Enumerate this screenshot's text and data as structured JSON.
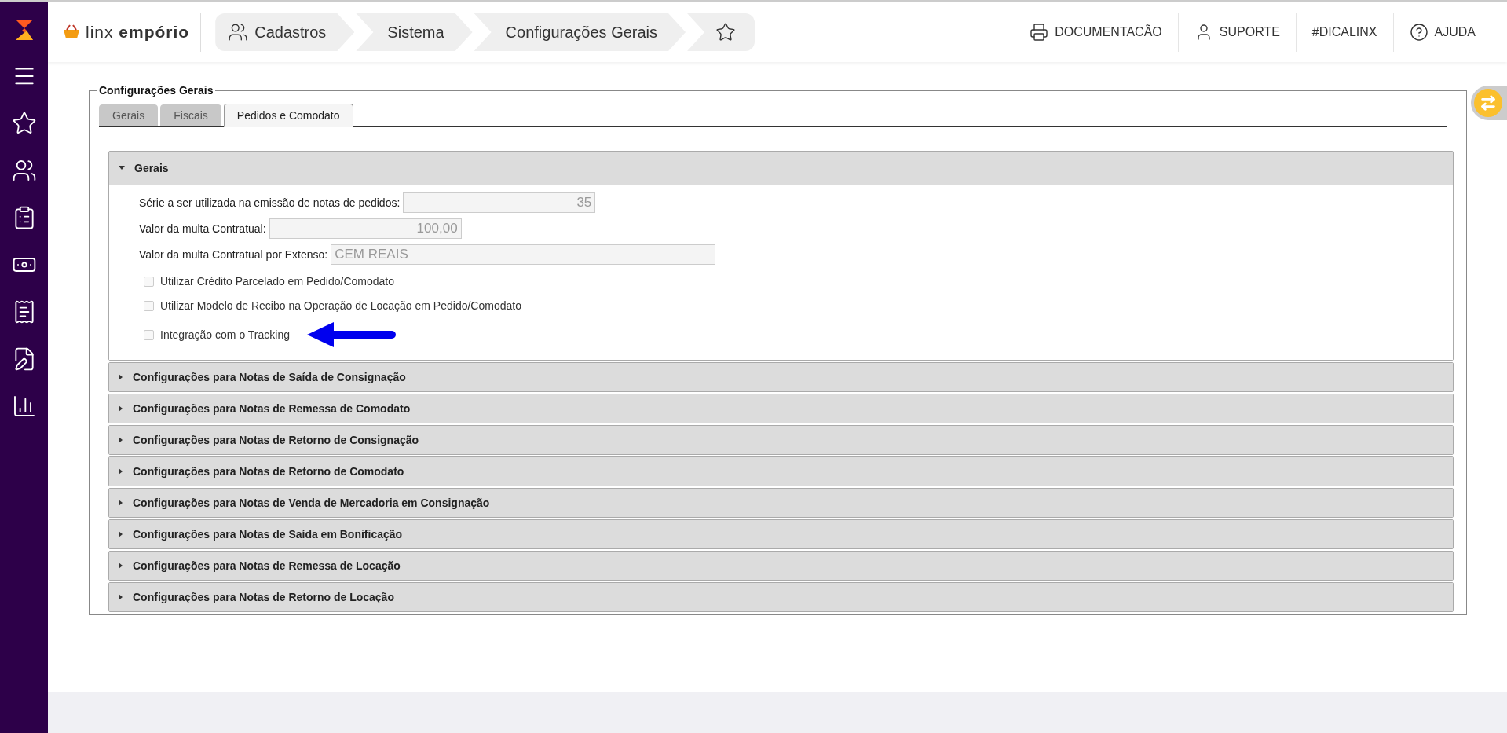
{
  "header": {
    "brand": {
      "part_1": "linx",
      "part_2": "empório"
    },
    "breadcrumbs": [
      {
        "label": "Cadastros",
        "kind": "people"
      },
      {
        "label": "Sistema",
        "kind": "plain"
      },
      {
        "label": "Configurações Gerais",
        "kind": "plain"
      },
      {
        "kind": "star"
      }
    ],
    "links": [
      {
        "label": "DOCUMENTACÃO",
        "kind": "doc"
      },
      {
        "label": "SUPORTE",
        "kind": "user"
      },
      {
        "label": "#DICALINX",
        "kind": "plain"
      },
      {
        "label": "AJUDA",
        "kind": "help"
      }
    ]
  },
  "sidebar": {
    "items": [
      {
        "kind": "menu"
      },
      {
        "kind": "star"
      },
      {
        "kind": "people"
      },
      {
        "kind": "clipboard"
      },
      {
        "kind": "money"
      },
      {
        "kind": "receipt"
      },
      {
        "kind": "edit"
      },
      {
        "kind": "chart"
      }
    ]
  },
  "fieldset": {
    "legend": "Configurações Gerais",
    "tabs": [
      {
        "label": "Gerais",
        "selected": false
      },
      {
        "label": "Fiscais",
        "selected": false
      },
      {
        "label": "Pedidos e Comodato",
        "selected": true
      }
    ],
    "sections": [
      {
        "title": "Gerais",
        "expanded": true,
        "fields": [
          {
            "label": "Série a ser utilizada na emissão de notas de pedidos:",
            "value": "35",
            "kind": "number"
          },
          {
            "label": "Valor da multa Contratual:",
            "value": "100,00",
            "kind": "number"
          },
          {
            "label": "Valor da multa Contratual por Extenso:",
            "value": "CEM REAIS",
            "kind": "text"
          }
        ],
        "checkboxes": [
          {
            "label": "Utilizar Crédito Parcelado em Pedido/Comodato",
            "checked": false,
            "disabled": true
          },
          {
            "label": "Utilizar Modelo de Recibo na Operação de Locação em Pedido/Comodato",
            "checked": false,
            "disabled": true
          },
          {
            "label": "Integração com o Tracking",
            "checked": false,
            "disabled": true,
            "arrow": true
          }
        ]
      },
      {
        "title": "Configurações para Notas de Saída de Consignação",
        "expanded": false
      },
      {
        "title": "Configurações para Notas de Remessa de Comodato",
        "expanded": false
      },
      {
        "title": "Configurações para Notas de Retorno de Consignação",
        "expanded": false
      },
      {
        "title": "Configurações para Notas de Retorno de Comodato",
        "expanded": false
      },
      {
        "title": "Configurações para Notas de Venda de Mercadoria em Consignação",
        "expanded": false
      },
      {
        "title": "Configurações para Notas de Saída em Bonificação",
        "expanded": false
      },
      {
        "title": "Configurações para Notas de Remessa de Locação",
        "expanded": false
      },
      {
        "title": "Configurações para Notas de Retorno de Locação",
        "expanded": false
      }
    ]
  }
}
